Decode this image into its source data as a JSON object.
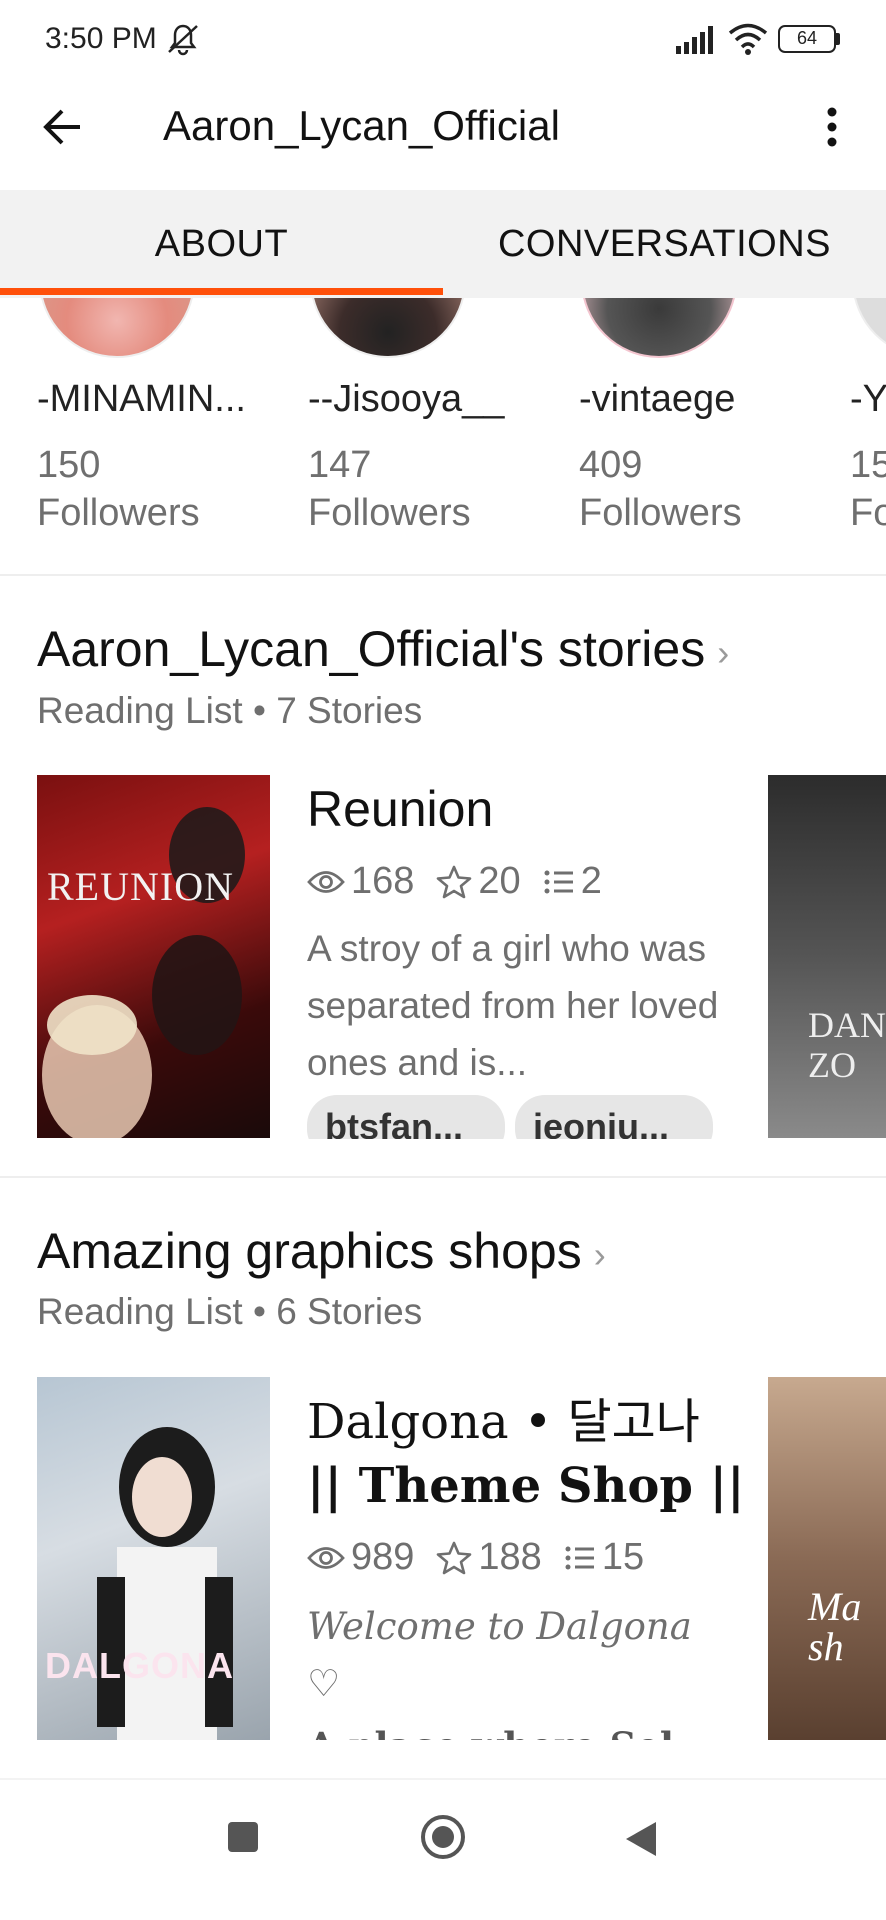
{
  "status": {
    "time": "3:50 PM",
    "battery": "64"
  },
  "app_bar": {
    "title": "Aaron_Lycan_Official"
  },
  "tabs": [
    {
      "label": "ABOUT",
      "active": true
    },
    {
      "label": "CONVERSATIONS",
      "active": false
    }
  ],
  "followers": [
    {
      "name": "-MINAMIN...",
      "count": "150",
      "label": "Followers"
    },
    {
      "name": "--Jisooya__",
      "count": "147",
      "label": "Followers"
    },
    {
      "name": "-vintaege",
      "count": "409",
      "label": "Followers"
    },
    {
      "name": "-Y",
      "count": "15",
      "label": "Fo"
    }
  ],
  "lists": [
    {
      "title": "Aaron_Lycan_Official's stories",
      "subtitle": "Reading List • 7 Stories",
      "story": {
        "title": "Reunion",
        "reads": "168",
        "votes": "20",
        "parts": "2",
        "description": "A stroy of a girl who was separated from her loved ones and is...",
        "tags": [
          "btsfan...",
          "jeonju..."
        ],
        "cover_text": "REUNION"
      },
      "next_cover_text": "DAN ZO"
    },
    {
      "title": "Amazing graphics shops",
      "subtitle": "Reading List • 6 Stories",
      "story": {
        "title_line1": "Dalgona • 달고나",
        "title_line2": "|| Theme Shop ||",
        "reads": "989",
        "votes": "188",
        "parts": "15",
        "description": "Welcome to Dalgona ♡",
        "description2": "A place where Sel",
        "cover_text": "DALGONA"
      },
      "next_cover_text": "Ma sh"
    }
  ],
  "colors": {
    "accent": "#ff500a",
    "muted": "#6f6f6f",
    "tab_bg": "#f2f2f2"
  }
}
